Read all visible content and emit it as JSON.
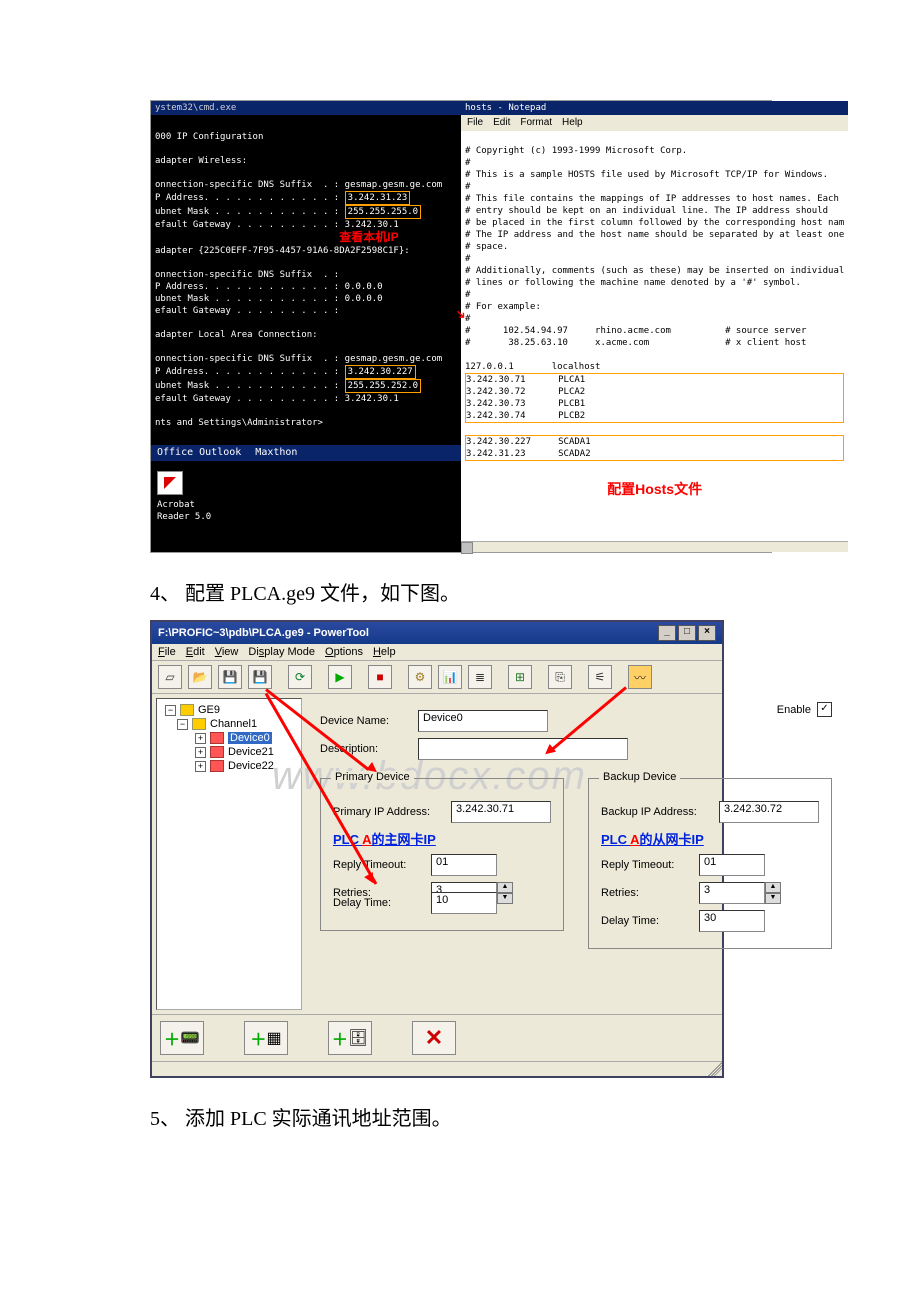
{
  "screenshot1": {
    "cmd_title": "ystem32\\cmd.exe",
    "cmd_lines": [
      "000 IP Configuration",
      "",
      "adapter Wireless:",
      "",
      "onnection-specific DNS Suffix  . : gesmap.gesm.ge.com",
      "P Address. . . . . . . . . . . . :",
      "ubnet Mask . . . . . . . . . . . :",
      "efault Gateway . . . . . . . . . :",
      "",
      "adapter {225C0EFF-7F95-4457-91A6-8DA2F2598C1F}:",
      "",
      "onnection-specific DNS Suffix  . :",
      "P Address. . . . . . . . . . . . : 0.0.0.0",
      "ubnet Mask . . . . . . . . . . . : 0.0.0.0",
      "efault Gateway . . . . . . . . . :",
      "",
      "adapter Local Area Connection:",
      "",
      "onnection-specific DNS Suffix  . : gesmap.gesm.ge.com",
      "P Address. . . . . . . . . . . . :",
      "ubnet Mask . . . . . . . . . . . :",
      "efault Gateway . . . . . . . . . :",
      "",
      "nts and Settings\\Administrator>"
    ],
    "ip_block1": {
      "ip": "3.242.31.23",
      "mask": "255.255.255.0",
      "gw": "3.242.30.1"
    },
    "ip_block2": {
      "ip": "3.242.30.227",
      "mask": "255.255.252.0",
      "gw": "3.242.30.1"
    },
    "red_label": "查看本机IP",
    "taskbar": {
      "item1": "Office Outlook",
      "item2": "Maxthon"
    },
    "acrobat": {
      "l1": "Acrobat",
      "l2": "Reader 5.0"
    },
    "np_title": "hosts - Notepad",
    "np_menu": [
      "File",
      "Edit",
      "Format",
      "Help"
    ],
    "np_text": [
      "# Copyright (c) 1993-1999 Microsoft Corp.",
      "#",
      "# This is a sample HOSTS file used by Microsoft TCP/IP for Windows.",
      "#",
      "# This file contains the mappings of IP addresses to host names. Each",
      "# entry should be kept on an individual line. The IP address should",
      "# be placed in the first column followed by the corresponding host nam",
      "# The IP address and the host name should be separated by at least one",
      "# space.",
      "#",
      "# Additionally, comments (such as these) may be inserted on individual",
      "# lines or following the machine name denoted by a '#' symbol.",
      "#",
      "# For example:",
      "#",
      "#      102.54.94.97     rhino.acme.com          # source server",
      "#       38.25.63.10     x.acme.com              # x client host",
      "",
      "127.0.0.1       localhost"
    ],
    "np_hl1": [
      "3.242.30.71      PLCA1",
      "3.242.30.72      PLCA2",
      "3.242.30.73      PLCB1",
      "3.242.30.74      PLCB2"
    ],
    "np_hl2": [
      "3.242.30.227     SCADA1",
      "3.242.31.23      SCADA2"
    ],
    "np_red": "配置Hosts文件"
  },
  "caption4": "4、 配置 PLCA.ge9 文件，如下图。",
  "caption5": "5、 添加 PLC 实际通讯地址范围。",
  "powertool": {
    "title": "F:\\PROFIC~3\\pdb\\PLCA.ge9 - PowerTool",
    "menu": [
      "File",
      "Edit",
      "View",
      "Display Mode",
      "Options",
      "Help"
    ],
    "tree": {
      "root": "GE9",
      "channel": "Channel1",
      "devices": [
        "Device0",
        "Device21",
        "Device22"
      ]
    },
    "form": {
      "device_name_lbl": "Device Name:",
      "device_name_val": "Device0",
      "enable_lbl": "Enable",
      "desc_lbl": "Description:",
      "primary_legend": "Primary Device",
      "backup_legend": "Backup Device",
      "primary_ip_lbl": "Primary IP Address:",
      "primary_ip_val": "3.242.30.71",
      "backup_ip_lbl": "Backup IP Address:",
      "backup_ip_val": "3.242.30.72",
      "primary_note_a": "PLC ",
      "primary_note_b": "A",
      "primary_note_c": "的主网卡IP",
      "backup_note_a": "PLC ",
      "backup_note_b": "A",
      "backup_note_c": "的从网卡IP",
      "reply_lbl": "Reply Timeout:",
      "reply_p": "01",
      "reply_b": "01",
      "retries_lbl": "Retries:",
      "retries_p": "3",
      "retries_b": "3",
      "delay_lbl": "Delay Time:",
      "delay_p": "10",
      "delay_b": "30"
    },
    "watermark": "www.bdocx.com"
  }
}
